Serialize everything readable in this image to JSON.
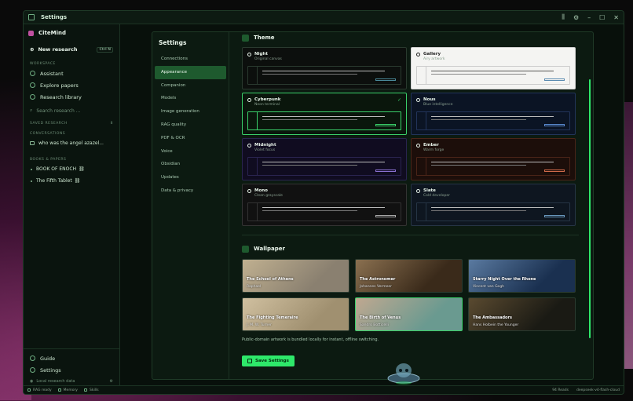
{
  "window": {
    "title": "Settings"
  },
  "sidebar": {
    "brand": "CiteMind",
    "new_research": "New research",
    "new_research_shortcut": "Ctrl N",
    "workspace_label": "WORKSPACE",
    "workspace_items": [
      {
        "label": "Assistant",
        "icon": "assistant-icon"
      },
      {
        "label": "Explore papers",
        "icon": "compass-icon"
      },
      {
        "label": "Research library",
        "icon": "library-icon"
      }
    ],
    "search_placeholder": "Search research ...",
    "saved_label": "SAVED RESEARCH",
    "saved_count": "8",
    "conversations_label": "CONVERSATIONS",
    "conversations": [
      "who was the angel azazel..."
    ],
    "books_label": "BOOKS & PAPERS",
    "books": [
      "BOOK OF ENOCH",
      "The Fifth Tablet"
    ],
    "guide": "Guide",
    "settings": "Settings",
    "local_data": "Local research data"
  },
  "settings": {
    "header": "Settings",
    "nav": [
      "Connections",
      "Appearance",
      "Companion",
      "Models",
      "Image generation",
      "RAG quality",
      "PDF & OCR",
      "Voice",
      "Obsidian",
      "Updates",
      "Data & privacy"
    ],
    "active_nav": "Appearance",
    "theme_header": "Theme",
    "themes": [
      {
        "name": "Night",
        "desc": "Original canvas",
        "bg": "#0c0f0d",
        "border": "#2a3a2f",
        "accent": "#4a8a9a",
        "selected": false,
        "light": false
      },
      {
        "name": "Gallery",
        "desc": "Airy artwork",
        "bg": "#f4f4f2",
        "border": "#d0d0d0",
        "accent": "#5a8ab0",
        "selected": false,
        "light": true
      },
      {
        "name": "Cyberpunk",
        "desc": "Neon terminal",
        "bg": "#0a160c",
        "border": "#3ad06a",
        "accent": "#3ad06a",
        "selected": true,
        "light": false
      },
      {
        "name": "Nous",
        "desc": "Blue intelligence",
        "bg": "#0b1424",
        "border": "#22345a",
        "accent": "#5a8ad0",
        "selected": false,
        "light": false
      },
      {
        "name": "Midnight",
        "desc": "Violet focus",
        "bg": "#100c20",
        "border": "#2a2450",
        "accent": "#8a70d0",
        "selected": false,
        "light": false
      },
      {
        "name": "Ember",
        "desc": "Warm forge",
        "bg": "#1c0e0a",
        "border": "#4a2418",
        "accent": "#d06a4a",
        "selected": false,
        "light": false
      },
      {
        "name": "Mono",
        "desc": "Clean grayscale",
        "bg": "#111111",
        "border": "#333333",
        "accent": "#aaaaaa",
        "selected": false,
        "light": false
      },
      {
        "name": "Slate",
        "desc": "Cold developer",
        "bg": "#0e1620",
        "border": "#263545",
        "accent": "#6a9ac0",
        "selected": false,
        "light": false
      }
    ],
    "wallpaper_header": "Wallpaper",
    "wallpapers": [
      {
        "title": "The School of Athens",
        "artist": "Raphael",
        "c1": "#8a8070",
        "c2": "#c0b090",
        "selected": false
      },
      {
        "title": "The Astronomer",
        "artist": "Johannes Vermeer",
        "c1": "#3a2a1a",
        "c2": "#8a7050",
        "selected": false
      },
      {
        "title": "Starry Night Over the Rhone",
        "artist": "Vincent van Gogh",
        "c1": "#1a3050",
        "c2": "#5a7aa0",
        "selected": false
      },
      {
        "title": "The Fighting Temeraire",
        "artist": "J. M. W. Turner",
        "c1": "#a09070",
        "c2": "#d0c0a0",
        "selected": false
      },
      {
        "title": "The Birth of Venus",
        "artist": "Sandro Botticelli",
        "c1": "#6a9a90",
        "c2": "#c0a890",
        "selected": true
      },
      {
        "title": "The Ambassadors",
        "artist": "Hans Holbein the Younger",
        "c1": "#1a1a14",
        "c2": "#5a4a30",
        "selected": false
      }
    ],
    "wallpaper_note": "Public-domain artwork is bundled locally for instant, offline switching.",
    "save_label": "Save Settings"
  },
  "statusbar": {
    "items": [
      "RAG ready",
      "Memory",
      "Skills"
    ],
    "reads": "94 Reads",
    "model": "deepseek-v4-flash-cloud"
  },
  "colors": {
    "accent": "#2ee86a",
    "active_nav": "#1e5a2e"
  }
}
